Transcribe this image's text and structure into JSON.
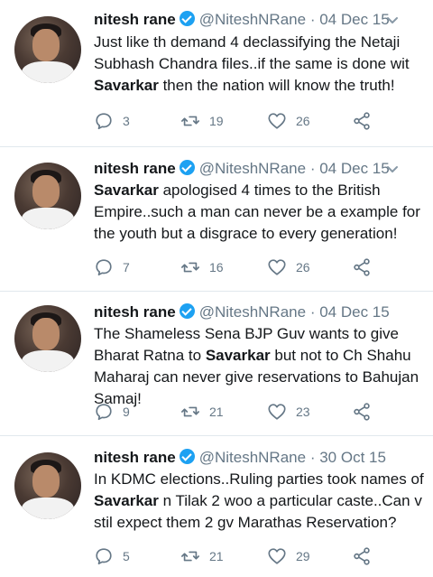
{
  "tweets": [
    {
      "name": "nitesh rane",
      "handle": "@NiteshNRane",
      "separator": "·",
      "date": "04 Dec 15",
      "text_before": "Just like th demand 4 declassifying the Netaji Subhash Chandra files..if the same is done wit ",
      "text_bold": "Savarkar",
      "text_after": " then the nation will know the truth!",
      "replies": "3",
      "retweets": "19",
      "likes": "26"
    },
    {
      "name": "nitesh rane",
      "handle": "@NiteshNRane",
      "separator": "·",
      "date": "04 Dec 15",
      "text_before": "",
      "text_bold": "Savarkar",
      "text_after": " apologised 4 times to the British Empire..such a man can never be a example for the youth but a disgrace to every generation!",
      "replies": "7",
      "retweets": "16",
      "likes": "26"
    },
    {
      "name": "nitesh rane",
      "handle": "@NiteshNRane",
      "separator": "·",
      "date": "04 Dec 15",
      "text_before": "The Shameless Sena BJP Guv wants to give Bharat Ratna to ",
      "text_bold": "Savarkar",
      "text_after": " but not to Ch Shahu Maharaj can never give reservations to Bahujan Samaj!",
      "replies": "9",
      "retweets": "21",
      "likes": "23"
    },
    {
      "name": "nitesh rane",
      "handle": "@NiteshNRane",
      "separator": "·",
      "date": "30 Oct 15",
      "text_before": "In KDMC elections..Ruling parties took names of ",
      "text_bold": "Savarkar",
      "text_after": " n Tilak 2 woo a particular caste..Can v stil expect them 2 gv Marathas Reservation?",
      "replies": "5",
      "retweets": "21",
      "likes": "29"
    }
  ],
  "icons": {
    "reply": "reply-icon",
    "retweet": "retweet-icon",
    "like": "heart-icon",
    "share": "share-icon",
    "menu": "chevron-down-icon",
    "verified": "verified-badge-icon"
  },
  "colors": {
    "verified": "#1da1f2",
    "muted": "#657786",
    "text": "#14171a",
    "divider": "#e1e8ed"
  }
}
